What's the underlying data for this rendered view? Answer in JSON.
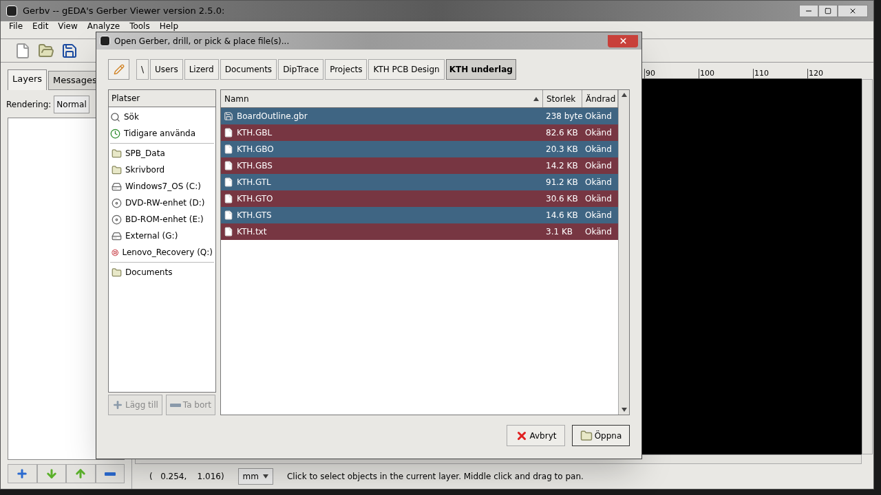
{
  "window": {
    "title": "Gerbv -- gEDA's Gerber Viewer version 2.5.0:"
  },
  "menu": [
    "File",
    "Edit",
    "View",
    "Analyze",
    "Tools",
    "Help"
  ],
  "side_tabs": [
    {
      "label": "Layers",
      "selected": true
    },
    {
      "label": "Messages",
      "selected": false
    }
  ],
  "rendering": {
    "label": "Rendering:",
    "value": "Normal"
  },
  "ruler": [
    "90",
    "100",
    "110",
    "120"
  ],
  "status_bar": {
    "coordinates": "(   0.254,    1.016)",
    "unit": "mm",
    "message": "Click to select objects in the current layer. Middle click and drag to pan."
  },
  "dialog": {
    "title": "Open Gerber, drill, or pick & place file(s)...",
    "path": [
      {
        "label": "\\",
        "selected": false
      },
      {
        "label": "Users",
        "selected": false
      },
      {
        "label": "Lizerd",
        "selected": false
      },
      {
        "label": "Documents",
        "selected": false
      },
      {
        "label": "DipTrace",
        "selected": false
      },
      {
        "label": "Projects",
        "selected": false
      },
      {
        "label": "KTH PCB Design",
        "selected": false
      },
      {
        "label": "KTH underlag",
        "selected": true
      }
    ],
    "places_header": "Platser",
    "place_groups": [
      [
        {
          "label": "Sök",
          "kind": "search"
        },
        {
          "label": "Tidigare använda",
          "kind": "recent"
        }
      ],
      [
        {
          "label": "SPB_Data",
          "kind": "folder"
        },
        {
          "label": "Skrivbord",
          "kind": "folder"
        },
        {
          "label": "Windows7_OS (C:)",
          "kind": "drive"
        },
        {
          "label": "DVD-RW-enhet (D:)",
          "kind": "optical"
        },
        {
          "label": "BD-ROM-enhet (E:)",
          "kind": "optical"
        },
        {
          "label": "External (G:)",
          "kind": "drive"
        },
        {
          "label": "Lenovo_Recovery (Q:)",
          "kind": "recovery"
        }
      ],
      [
        {
          "label": "Documents",
          "kind": "folder"
        }
      ]
    ],
    "columns": [
      {
        "label": "Namn",
        "sorted": true
      },
      {
        "label": "Storlek",
        "sorted": false
      },
      {
        "label": "Ändrad",
        "sorted": false
      }
    ],
    "rows": [
      {
        "name": "BoardOutline.gbr",
        "size": "238 byte",
        "modified": "Okänd",
        "kind": "gerber",
        "selected": true
      },
      {
        "name": "KTH.GBL",
        "size": "82.6 KB",
        "modified": "Okänd",
        "kind": "file",
        "selected": true
      },
      {
        "name": "KTH.GBO",
        "size": "20.3 KB",
        "modified": "Okänd",
        "kind": "file",
        "selected": true
      },
      {
        "name": "KTH.GBS",
        "size": "14.2 KB",
        "modified": "Okänd",
        "kind": "file",
        "selected": true
      },
      {
        "name": "KTH.GTL",
        "size": "91.2 KB",
        "modified": "Okänd",
        "kind": "file",
        "selected": true
      },
      {
        "name": "KTH.GTO",
        "size": "30.6 KB",
        "modified": "Okänd",
        "kind": "file",
        "selected": true
      },
      {
        "name": "KTH.GTS",
        "size": "14.6 KB",
        "modified": "Okänd",
        "kind": "file",
        "selected": true
      },
      {
        "name": "KTH.txt",
        "size": "3.1 KB",
        "modified": "Okänd",
        "kind": "file",
        "selected": true
      }
    ],
    "place_buttons": [
      {
        "label": "Lägg till",
        "kind": "add",
        "disabled": true
      },
      {
        "label": "Ta bort",
        "kind": "remove",
        "disabled": true
      }
    ],
    "buttons": [
      {
        "label": "Avbryt",
        "kind": "cancel"
      },
      {
        "label": "Öppna",
        "kind": "open"
      }
    ]
  }
}
